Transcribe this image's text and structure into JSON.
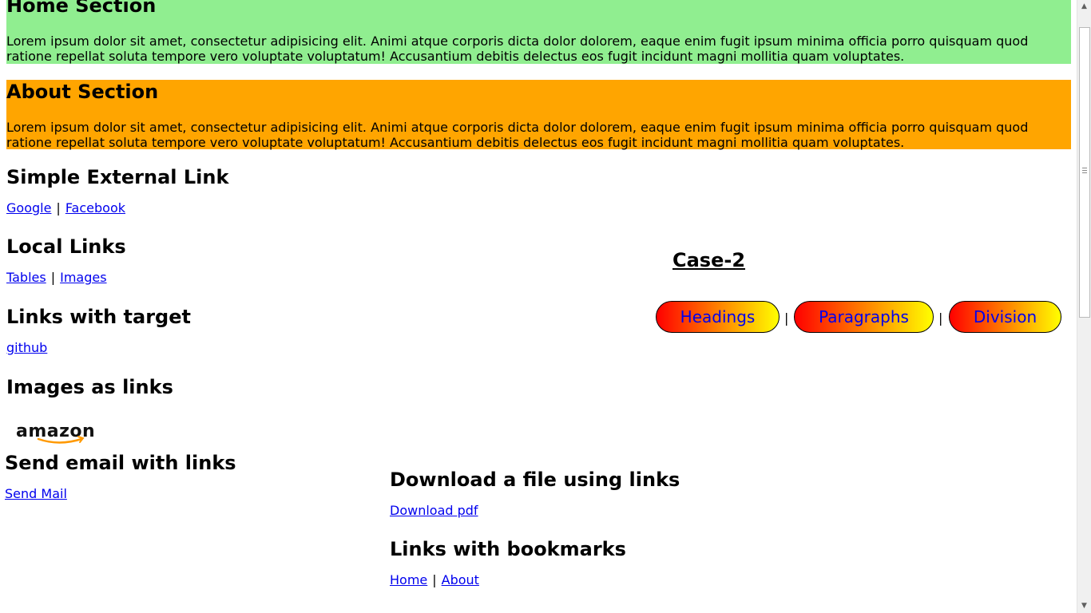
{
  "home": {
    "title": "Home Section",
    "text": "Lorem ipsum dolor sit amet, consectetur adipisicing elit. Animi atque corporis dicta dolor dolorem, eaque enim fugit ipsum minima officia porro quisquam quod ratione repellat soluta tempore vero voluptate voluptatum! Accusantium debitis delectus eos fugit incidunt magni mollitia quam voluptates.",
    "color": "#90ee90"
  },
  "about": {
    "title": "About Section",
    "text": "Lorem ipsum dolor sit amet, consectetur adipisicing elit. Animi atque corporis dicta dolor dolorem, eaque enim fugit ipsum minima officia porro quisquam quod ratione repellat soluta tempore vero voluptate voluptatum! Accusantium debitis delectus eos fugit incidunt magni mollitia quam voluptates.",
    "color": "#ffa500"
  },
  "external": {
    "title": "Simple External Link",
    "links": [
      "Google",
      "Facebook"
    ]
  },
  "local": {
    "title": "Local Links",
    "links": [
      "Tables",
      "Images"
    ]
  },
  "target": {
    "title": "Links with target",
    "links": [
      "github"
    ]
  },
  "images": {
    "title": "Images as links",
    "logo_text": "amazon",
    "logo_icon": "amazon-logo"
  },
  "email": {
    "title": "Send email with links",
    "links": [
      "Send Mail"
    ]
  },
  "download": {
    "title": "Download a file using links",
    "links": [
      "Download pdf"
    ]
  },
  "bookmarks": {
    "title": "Links with bookmarks",
    "links": [
      "Home",
      "About"
    ]
  },
  "case2": {
    "title": "Case-2",
    "buttons": [
      "Headings",
      "Paragraphs",
      "Division"
    ],
    "separator": "|"
  },
  "separator": "|",
  "colors": {
    "link": "#0000ee",
    "pill_start": "#ff0000",
    "pill_end": "#ffff00"
  }
}
